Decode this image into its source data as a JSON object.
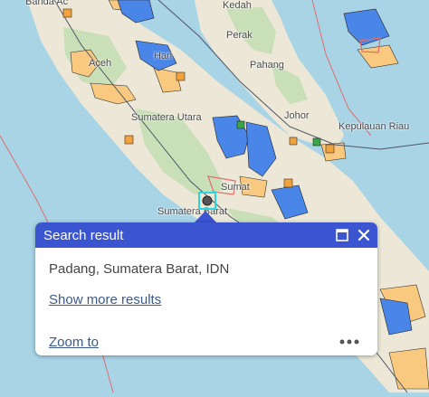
{
  "map": {
    "labels": {
      "banda_aceh": "Banda Ac",
      "kedah": "Kedah",
      "perak": "Perak",
      "medan": "Han",
      "aceh": "Aceh",
      "pahang": "Pahang",
      "sumatera_utara": "Sumatera Utara",
      "johor": "Johor",
      "kepulauan_riau": "Kepulauan Riau",
      "sumat": "Sumat",
      "sumatera_barat": "Sumatera Barat"
    },
    "colors": {
      "sea": "#a8d4e6",
      "land": "#ece7d6",
      "forest": "#c9dfb8",
      "protected_area": "#4a86e8",
      "concession": "#f9c97f",
      "boundary": "#4d5563",
      "boundary_red": "#e06c6c"
    },
    "selected_marker_icon": "location-marker-icon"
  },
  "popup": {
    "title": "Search result",
    "address": "Padang, Sumatera Barat, IDN",
    "show_more": "Show more results",
    "zoom_to": "Zoom to",
    "maximize_icon": "maximize-icon",
    "close_icon": "close-icon",
    "more_icon": "more-options-icon",
    "header_color": "#3a55cf"
  }
}
